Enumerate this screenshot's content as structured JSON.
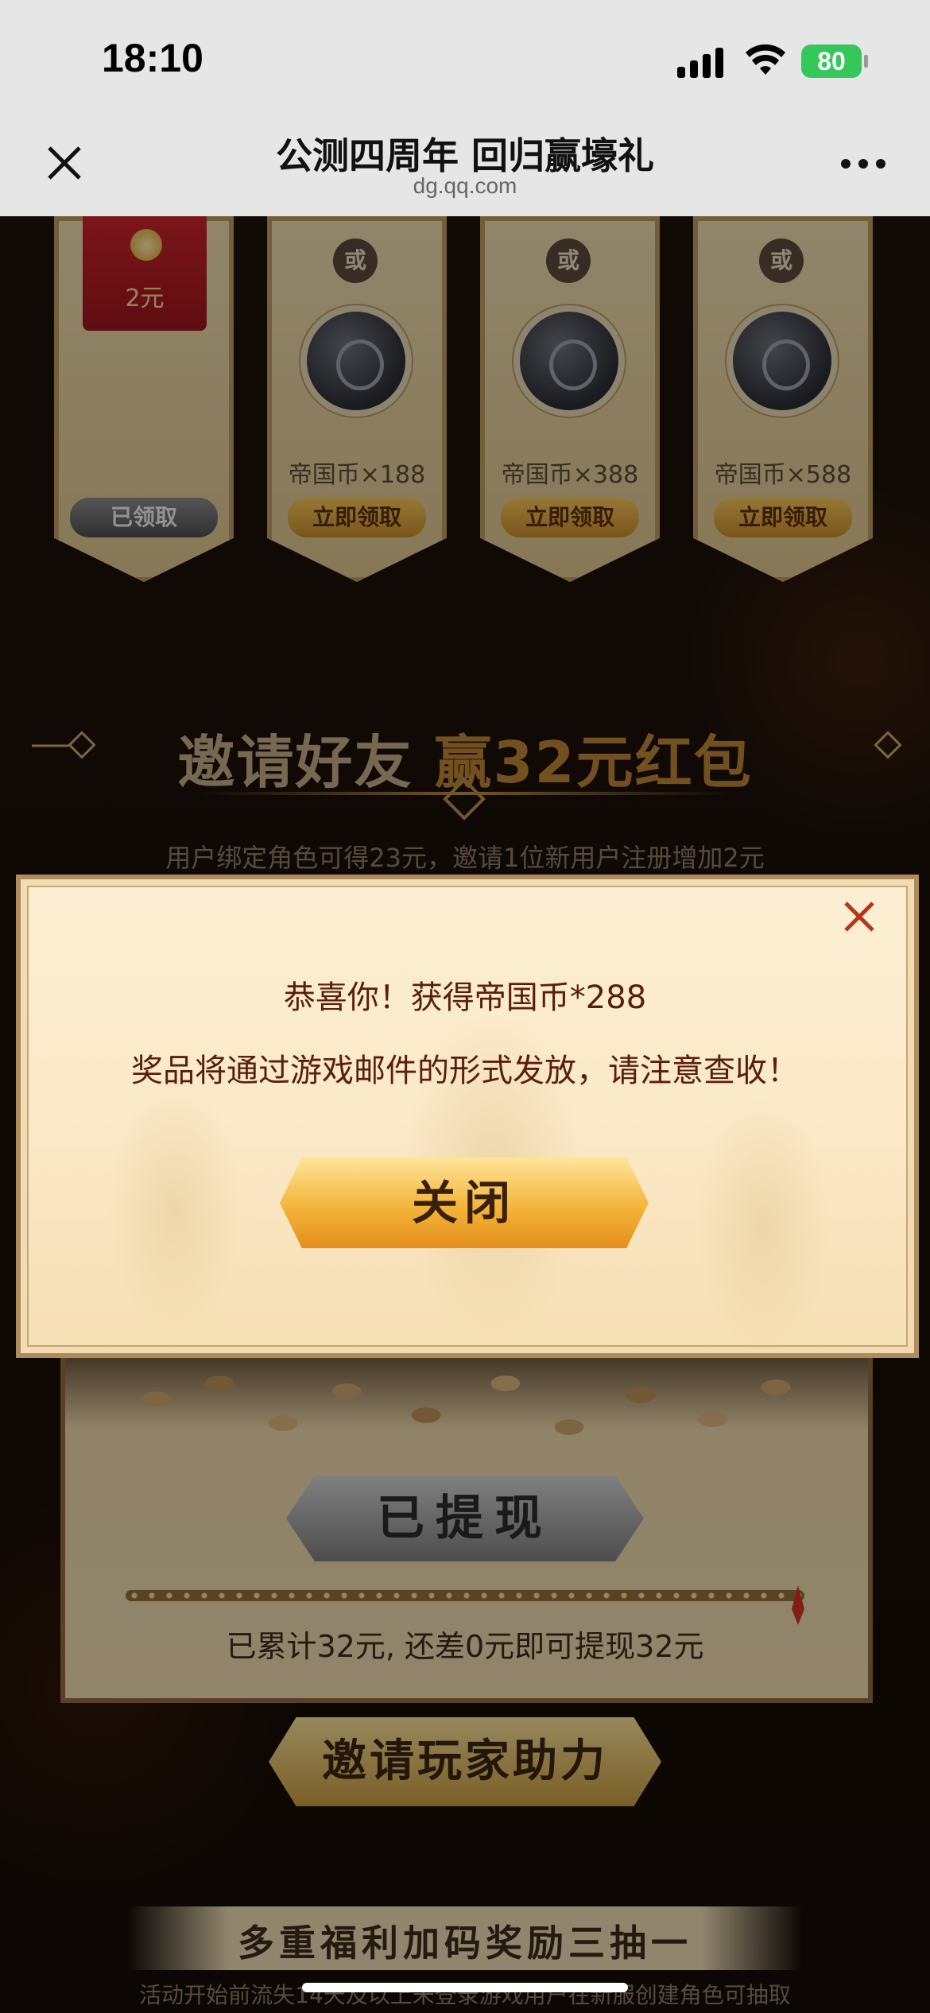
{
  "status_bar": {
    "time": "18:10",
    "battery": "80"
  },
  "nav": {
    "title": "公测四周年 回归赢壕礼",
    "url": "dg.qq.com"
  },
  "rewards": {
    "envelope_amount": "2元",
    "or_label": "或",
    "claimed_label": "已领取",
    "items": [
      {
        "label": "帝国币×188",
        "button": "立即领取"
      },
      {
        "label": "帝国币×388",
        "button": "立即领取"
      },
      {
        "label": "帝国币×588",
        "button": "立即领取"
      }
    ]
  },
  "invite": {
    "title_part1": "邀请好友",
    "title_part2": "赢32元红包",
    "subtitle": "用户绑定角色可得23元，邀请1位新用户注册增加2元"
  },
  "panel": {
    "withdrawn_label": "已提现",
    "progress": 1.0,
    "accumulated_text": "已累计32元, 还差0元即可提现32元",
    "invite_button": "邀请玩家助力"
  },
  "bonus": {
    "title": "多重福利加码奖励三抽一",
    "subtitle": "活动开始前流失14天及以上未登录游戏用户在新服创建角色可抽取"
  },
  "modal": {
    "line1": "恭喜你！获得帝国币*288",
    "line2": "奖品将通过游戏邮件的形式发放，请注意查收！",
    "close_button": "关闭"
  },
  "colors": {
    "accent_gold": "#b88232",
    "modal_text": "#5a1e0c",
    "battery_green": "#34c759"
  }
}
